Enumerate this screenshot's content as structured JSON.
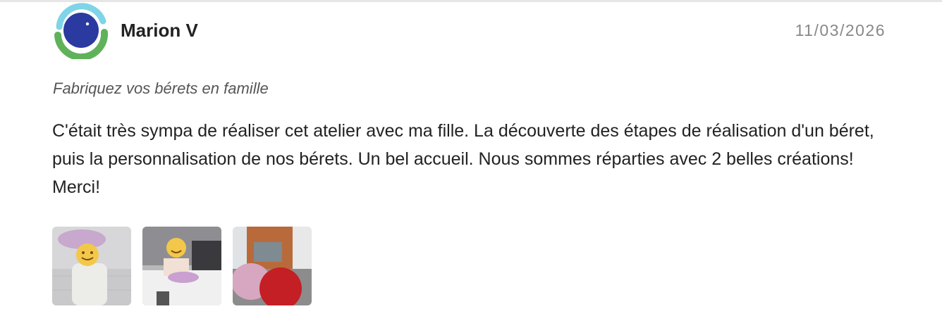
{
  "review": {
    "author": "Marion V",
    "date": "11/03/2026",
    "product": "Fabriquez vos bérets en famille",
    "text": "C'était très sympa de réaliser cet atelier avec ma fille. La découverte des étapes de réalisation d'un béret, puis la personnalisation de nos bérets. Un bel accueil. Nous sommes réparties avec 2 belles créations!  Merci!"
  },
  "avatar": {
    "icon": "logo-avatar-icon",
    "colors": {
      "ring_top": "#7fd4e8",
      "ring_bottom": "#5fb25a",
      "center": "#2b3aa0"
    }
  },
  "photos": [
    {
      "name": "photo-child-wearing-beret"
    },
    {
      "name": "photo-child-at-table"
    },
    {
      "name": "photo-berets-outside-shop"
    }
  ]
}
